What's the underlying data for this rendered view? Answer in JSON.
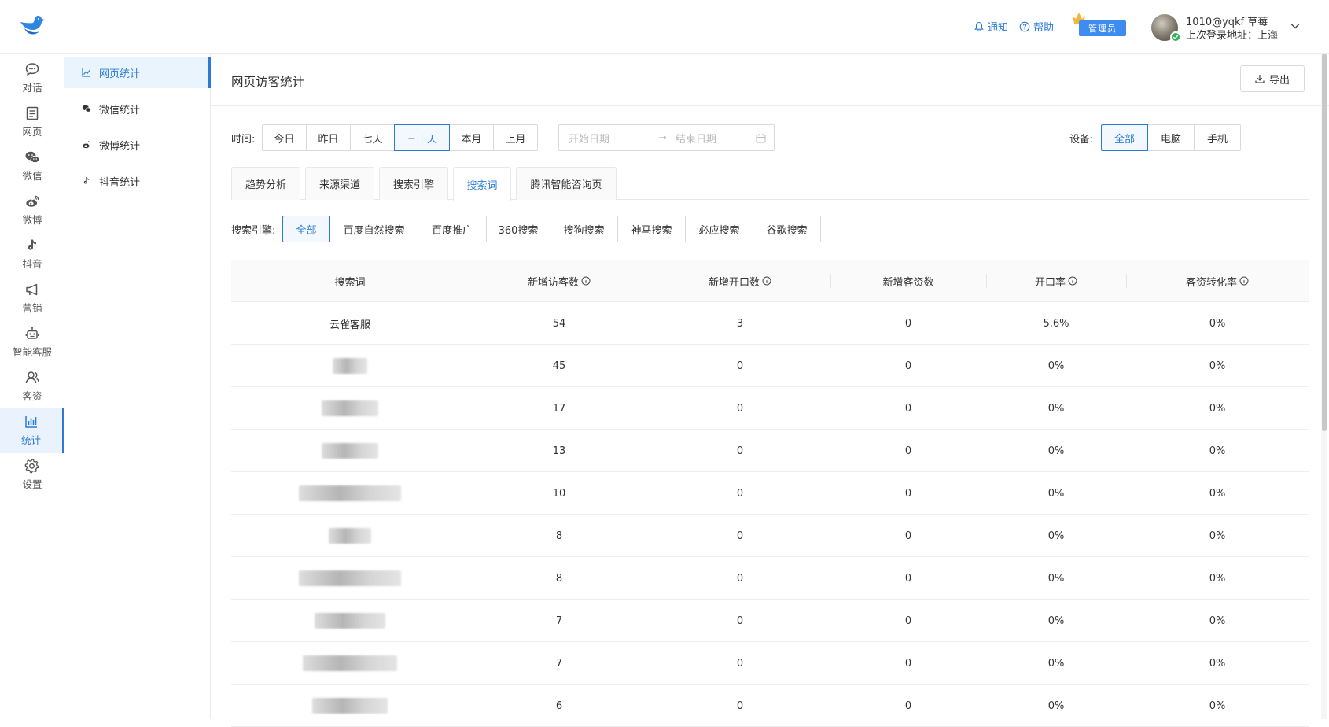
{
  "header": {
    "notify_label": "通知",
    "help_label": "帮助",
    "admin_label": "管理员",
    "user_name": "1010@yqkf 草莓",
    "last_login": "上次登录地址：上海"
  },
  "rail": {
    "items": [
      {
        "label": "对话",
        "icon": "chat-icon"
      },
      {
        "label": "网页",
        "icon": "webpage-icon"
      },
      {
        "label": "微信",
        "icon": "wechat-icon"
      },
      {
        "label": "微博",
        "icon": "weibo-icon"
      },
      {
        "label": "抖音",
        "icon": "douyin-icon"
      },
      {
        "label": "营销",
        "icon": "megaphone-icon"
      },
      {
        "label": "智能客服",
        "icon": "robot-icon"
      },
      {
        "label": "客资",
        "icon": "customers-icon"
      },
      {
        "label": "统计",
        "icon": "stats-icon",
        "active": true
      },
      {
        "label": "设置",
        "icon": "gear-icon"
      }
    ]
  },
  "submenu": {
    "items": [
      {
        "label": "网页统计",
        "icon": "line-chart-icon",
        "active": true
      },
      {
        "label": "微信统计",
        "icon": "wechat-icon"
      },
      {
        "label": "微博统计",
        "icon": "weibo-icon"
      },
      {
        "label": "抖音统计",
        "icon": "douyin-icon"
      }
    ]
  },
  "main": {
    "title": "网页访客统计",
    "export_label": "导出",
    "time_label": "时间:",
    "time_options": [
      "今日",
      "昨日",
      "七天",
      "三十天",
      "本月",
      "上月"
    ],
    "time_selected": "三十天",
    "date_start_placeholder": "开始日期",
    "date_end_placeholder": "结束日期",
    "device_label": "设备:",
    "device_options": [
      "全部",
      "电脑",
      "手机"
    ],
    "device_selected": "全部",
    "tabs": [
      "趋势分析",
      "来源渠道",
      "搜索引擎",
      "搜索词",
      "腾讯智能咨询页"
    ],
    "tab_selected": "搜索词",
    "engine_label": "搜索引擎:",
    "engine_options": [
      "全部",
      "百度自然搜索",
      "百度推广",
      "360搜索",
      "搜狗搜索",
      "神马搜索",
      "必应搜索",
      "谷歌搜索"
    ],
    "engine_selected": "全部"
  },
  "table": {
    "columns": [
      "搜索词",
      "新增访客数",
      "新增开口数",
      "新增客资数",
      "开口率",
      "客资转化率"
    ],
    "rows": [
      [
        "云雀客服",
        "54",
        "3",
        "0",
        "5.6%",
        "0%"
      ],
      [
        "",
        "45",
        "0",
        "0",
        "0%",
        "0%"
      ],
      [
        "",
        "17",
        "0",
        "0",
        "0%",
        "0%"
      ],
      [
        "",
        "13",
        "0",
        "0",
        "0%",
        "0%"
      ],
      [
        "",
        "10",
        "0",
        "0",
        "0%",
        "0%"
      ],
      [
        "",
        "8",
        "0",
        "0",
        "0%",
        "0%"
      ],
      [
        "",
        "8",
        "0",
        "0",
        "0%",
        "0%"
      ],
      [
        "",
        "7",
        "0",
        "0",
        "0%",
        "0%"
      ],
      [
        "",
        "7",
        "0",
        "0",
        "0%",
        "0%"
      ],
      [
        "",
        "6",
        "0",
        "0",
        "0%",
        "0%"
      ]
    ]
  },
  "colors": {
    "accent": "#2b7bd6",
    "admin_badge": "#3f8cf0",
    "online": "#2fb35a"
  }
}
